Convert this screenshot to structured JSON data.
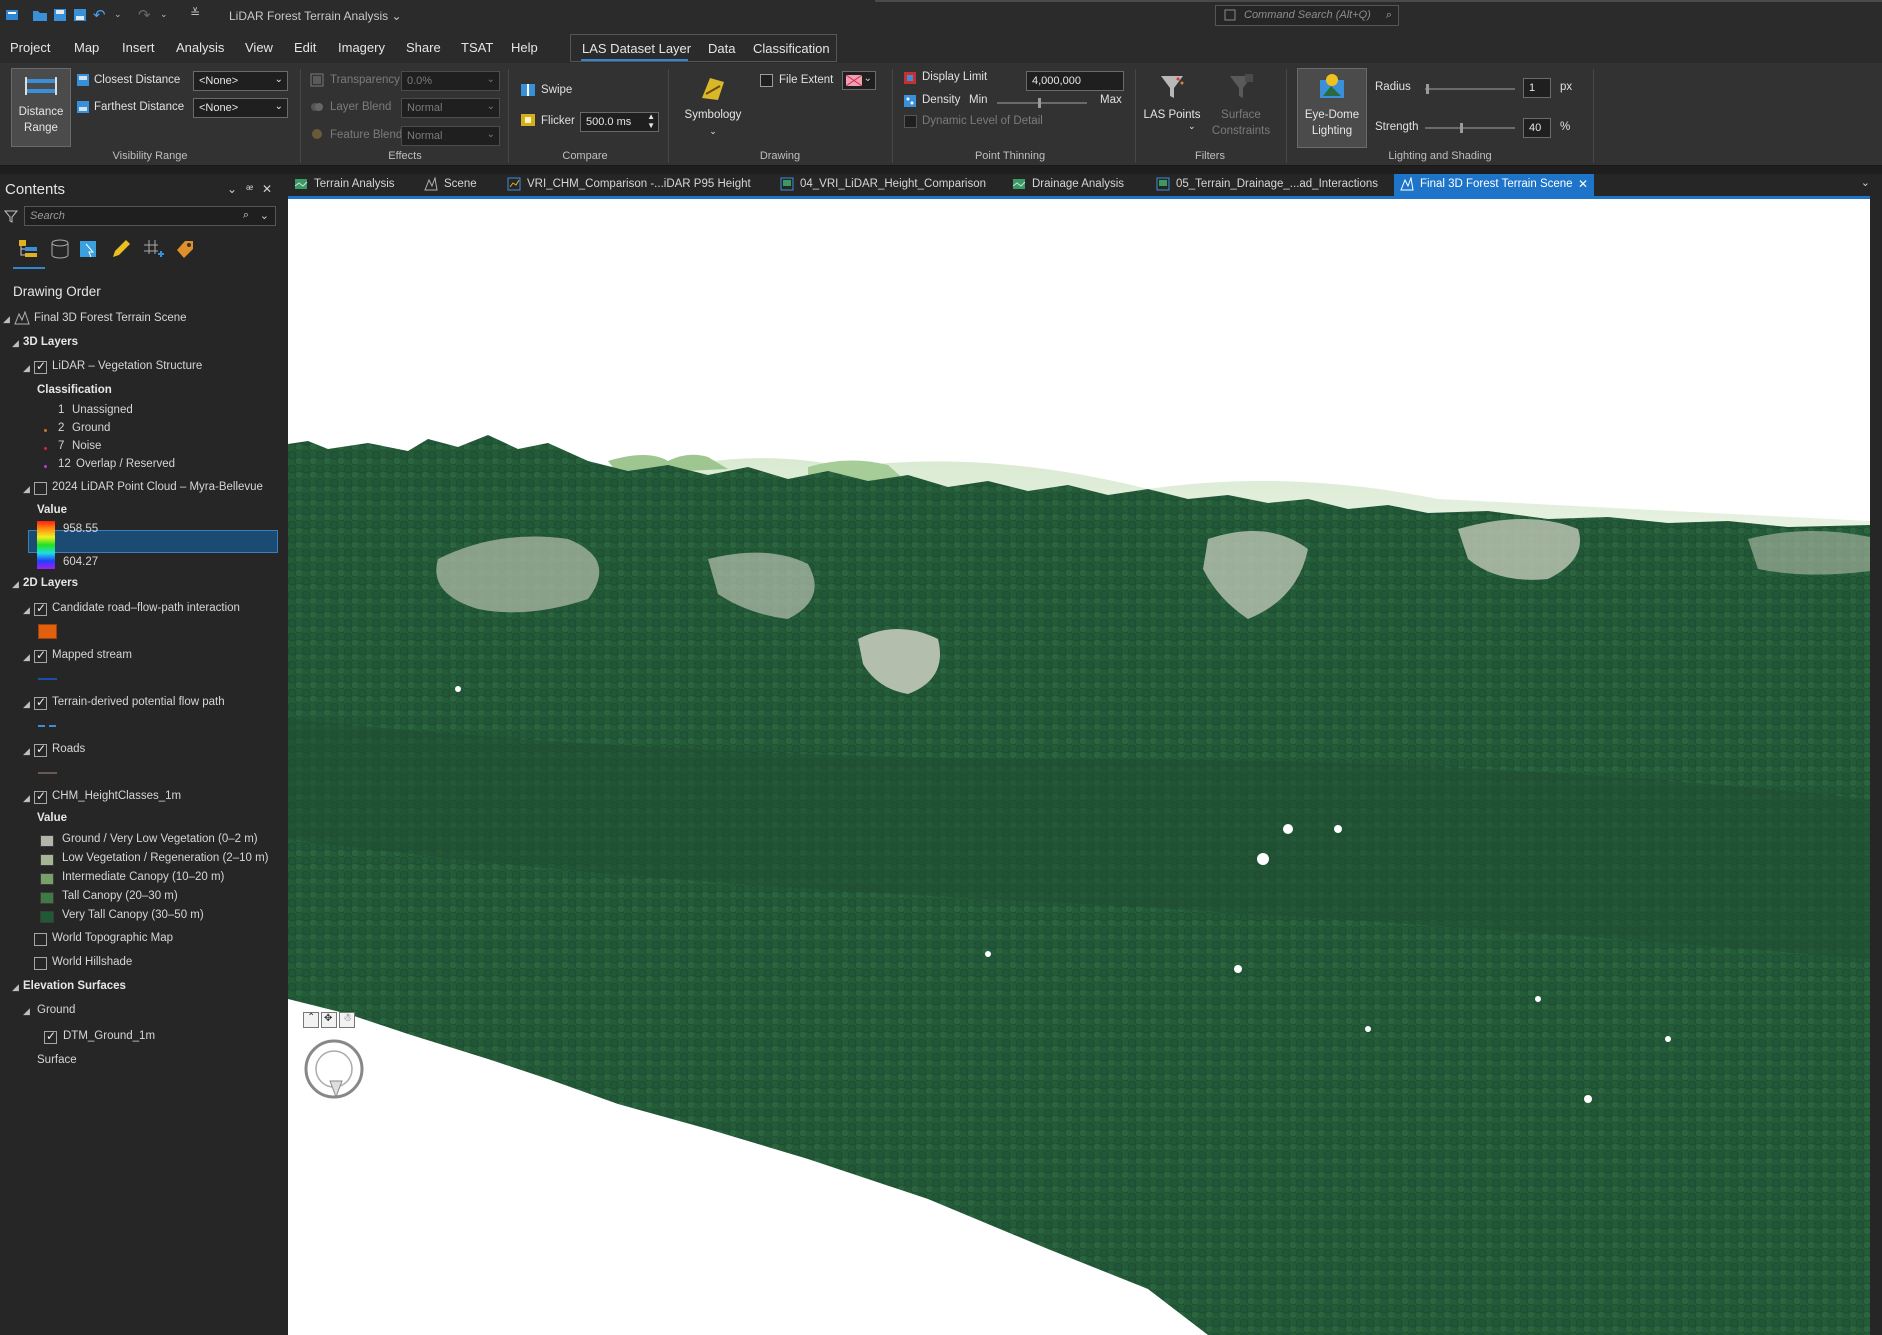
{
  "titlebar": {
    "app_title": "LiDAR Forest Terrain Analysis ⌄",
    "command_search_placeholder": "Command Search (Alt+Q)"
  },
  "menu": {
    "items": [
      "Project",
      "Map",
      "Insert",
      "Analysis",
      "View",
      "Edit",
      "Imagery",
      "Share",
      "TSAT",
      "Help"
    ],
    "context_tabs": [
      "LAS Dataset Layer",
      "Data",
      "Classification"
    ]
  },
  "ribbon": {
    "visibility_range": {
      "distance_range_label": "Distance Range",
      "closest_distance_label": "Closest Distance",
      "closest_distance_value": "<None>",
      "farthest_distance_label": "Farthest Distance",
      "farthest_distance_value": "<None>",
      "group_label": "Visibility Range"
    },
    "effects": {
      "transparency_label": "Transparency",
      "transparency_value": "0.0%",
      "layer_blend_label": "Layer Blend",
      "layer_blend_value": "Normal",
      "feature_blend_label": "Feature Blend",
      "feature_blend_value": "Normal",
      "group_label": "Effects"
    },
    "compare": {
      "swipe_label": "Swipe",
      "flicker_label": "Flicker",
      "flicker_value": "500.0  ms",
      "group_label": "Compare"
    },
    "drawing": {
      "symbology_label": "Symbology",
      "file_extent_label": "File Extent",
      "group_label": "Drawing"
    },
    "point_thinning": {
      "display_limit_label": "Display Limit",
      "display_limit_value": "4,000,000",
      "density_label": "Density",
      "min_label": "Min",
      "max_label": "Max",
      "density_level": 0.45,
      "dynamic_lod_label": "Dynamic Level of Detail",
      "group_label": "Point Thinning"
    },
    "filters": {
      "las_points_label": "LAS Points",
      "surface_constraints_label": "Surface Constraints",
      "group_label": "Filters"
    },
    "lighting": {
      "eye_dome_label": "Eye-Dome Lighting",
      "radius_label": "Radius",
      "radius_value": "1",
      "radius_unit": "px",
      "strength_label": "Strength",
      "strength_value": "40",
      "strength_unit": "%",
      "group_label": "Lighting and Shading"
    }
  },
  "contents": {
    "title": "Contents",
    "search_placeholder": "Search",
    "drawing_order": "Drawing Order",
    "scene_name": "Final 3D Forest Terrain Scene",
    "layers_3d": "3D Layers",
    "lidar_layer": "LiDAR – Vegetation Structure",
    "classification_label": "Classification",
    "classes": [
      {
        "code": "1",
        "name": "Unassigned",
        "color": "#262626"
      },
      {
        "code": "2",
        "name": "Ground",
        "color": "#c8781e"
      },
      {
        "code": "7",
        "name": "Noise",
        "color": "#e0203c"
      },
      {
        "code": "12",
        "name": "Overlap / Reserved",
        "color": "#b040d0"
      }
    ],
    "point_cloud_layer": "2024 LiDAR Point Cloud – Myra-Bellevue",
    "value_label": "Value",
    "ramp_max": "958.55",
    "ramp_min": "604.27",
    "layers_2d": "2D Layers",
    "road_flow_layer": "Candidate road–flow-path interaction",
    "mapped_stream_layer": "Mapped stream",
    "flow_path_layer": "Terrain-derived potential flow path",
    "roads_layer": "Roads",
    "chm_layer": "CHM_HeightClasses_1m",
    "chm_value_label": "Value",
    "chm_classes": [
      {
        "name": "Ground / Very Low Vegetation (0–2 m)",
        "color": "#b4b4aa"
      },
      {
        "name": "Low Vegetation / Regeneration (2–10 m)",
        "color": "#a8b496"
      },
      {
        "name": "Intermediate Canopy (10–20 m)",
        "color": "#7aa06a"
      },
      {
        "name": "Tall Canopy (20–30 m)",
        "color": "#3f7a45"
      },
      {
        "name": "Very Tall Canopy (30–50 m)",
        "color": "#1f5a34"
      }
    ],
    "topo_layer": "World Topographic Map",
    "hillshade_layer": "World Hillshade",
    "elevation_surfaces": "Elevation Surfaces",
    "ground_label": "Ground",
    "dtm_layer": "DTM_Ground_1m",
    "surface_label": "Surface"
  },
  "doc_tabs": [
    {
      "label": "Terrain Analysis",
      "active": false
    },
    {
      "label": "Scene",
      "active": false
    },
    {
      "label": "VRI_CHM_Comparison -...iDAR P95 Height",
      "active": false
    },
    {
      "label": "04_VRI_LiDAR_Height_Comparison",
      "active": false
    },
    {
      "label": "Drainage Analysis",
      "active": false
    },
    {
      "label": "05_Terrain_Drainage_...ad_Interactions",
      "active": false
    },
    {
      "label": "Final 3D Forest Terrain Scene",
      "active": true
    }
  ],
  "colors": {
    "accent": "#1d74c9",
    "canopy_dark": "#1f5a34",
    "canopy_mid": "#2b6a3e",
    "open_ground": "#b4beac",
    "sky": "#ffffff"
  }
}
